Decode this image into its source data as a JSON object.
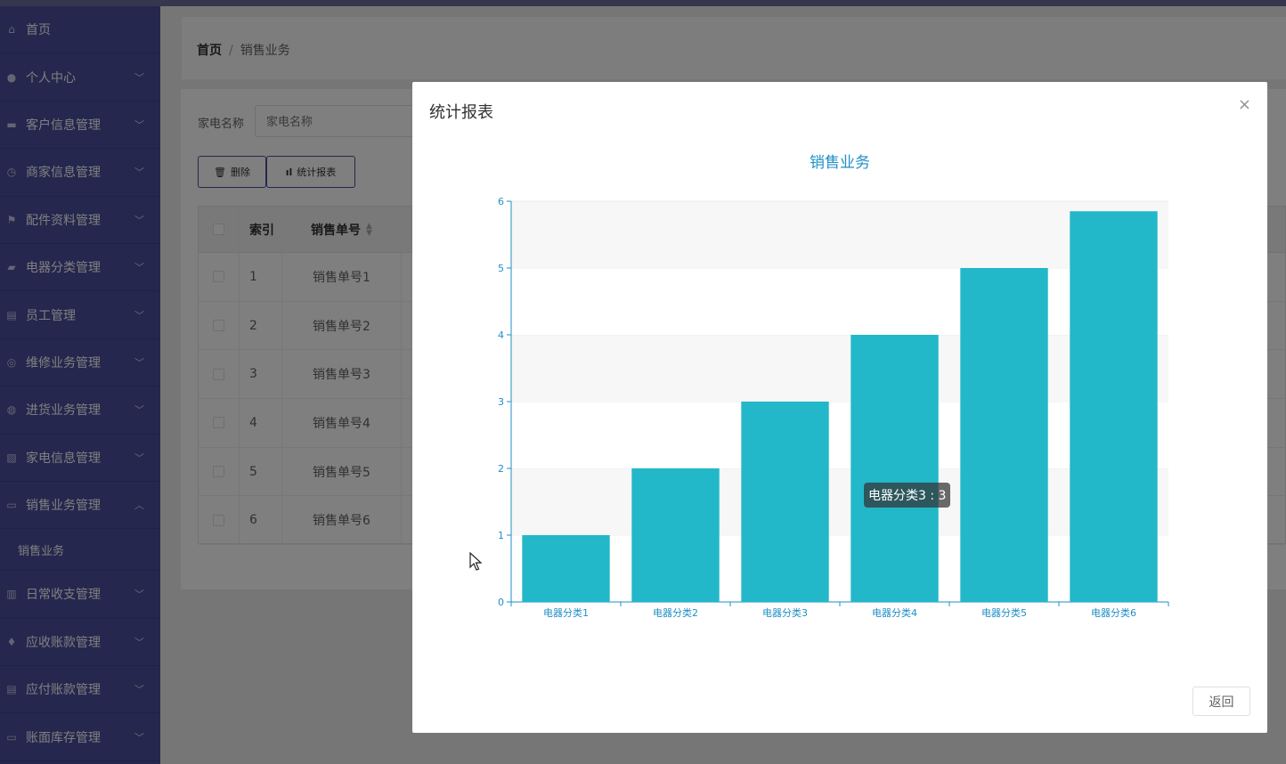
{
  "sidebar": {
    "items": [
      {
        "label": "首页",
        "icon": "home-icon",
        "chevron": false
      },
      {
        "label": "个人中心",
        "icon": "user-icon",
        "chevron": true
      },
      {
        "label": "客户信息管理",
        "icon": "chat-icon",
        "chevron": true
      },
      {
        "label": "商家信息管理",
        "icon": "clock-icon",
        "chevron": true
      },
      {
        "label": "配件资料管理",
        "icon": "flag-icon",
        "chevron": true
      },
      {
        "label": "电器分类管理",
        "icon": "thumb-icon",
        "chevron": true
      },
      {
        "label": "员工管理",
        "icon": "clipboard-icon",
        "chevron": true
      },
      {
        "label": "维修业务管理",
        "icon": "compass-icon",
        "chevron": true
      },
      {
        "label": "进货业务管理",
        "icon": "globe-icon",
        "chevron": true
      },
      {
        "label": "家电信息管理",
        "icon": "image-icon",
        "chevron": true
      },
      {
        "label": "销售业务管理",
        "icon": "briefcase-icon",
        "chevron": true,
        "expanded": true
      }
    ],
    "sub_item": "销售业务",
    "items_after": [
      {
        "label": "日常收支管理",
        "icon": "chart-icon",
        "chevron": true
      },
      {
        "label": "应收账款管理",
        "icon": "mic-icon",
        "chevron": true
      },
      {
        "label": "应付账款管理",
        "icon": "clipboard-icon",
        "chevron": true
      },
      {
        "label": "账面库存管理",
        "icon": "monitor-icon",
        "chevron": true
      }
    ]
  },
  "breadcrumb": {
    "home": "首页",
    "separator": "/",
    "current": "销售业务"
  },
  "search": {
    "label": "家电名称",
    "placeholder": "家电名称"
  },
  "toolbar": {
    "delete_label": "删除",
    "stats_label": "统计报表"
  },
  "table": {
    "headers": {
      "index": "索引",
      "order_no": "销售单号"
    },
    "rows": [
      {
        "index": "1",
        "order_no": "销售单号1"
      },
      {
        "index": "2",
        "order_no": "销售单号2"
      },
      {
        "index": "3",
        "order_no": "销售单号3"
      },
      {
        "index": "4",
        "order_no": "销售单号4"
      },
      {
        "index": "5",
        "order_no": "销售单号5"
      },
      {
        "index": "6",
        "order_no": "销售单号6"
      }
    ]
  },
  "modal": {
    "title": "统计报表",
    "close_glyph": "×",
    "return_label": "返回",
    "tooltip": "电器分类3 : 3"
  },
  "colors": {
    "sidebar": "#4a4f9d",
    "bar": "#22b8c9",
    "chart_title": "#1f8fc4",
    "axis": "#1f8fc4"
  },
  "chart_data": {
    "type": "bar",
    "title": "销售业务",
    "categories": [
      "电器分类1",
      "电器分类2",
      "电器分类3",
      "电器分类4",
      "电器分类5",
      "电器分类6"
    ],
    "values": [
      1,
      2,
      3,
      4,
      5,
      5.85
    ],
    "ylim": [
      0,
      6
    ],
    "yticks": [
      "0",
      "1",
      "2",
      "3",
      "4",
      "5",
      "6"
    ],
    "grid": true
  }
}
